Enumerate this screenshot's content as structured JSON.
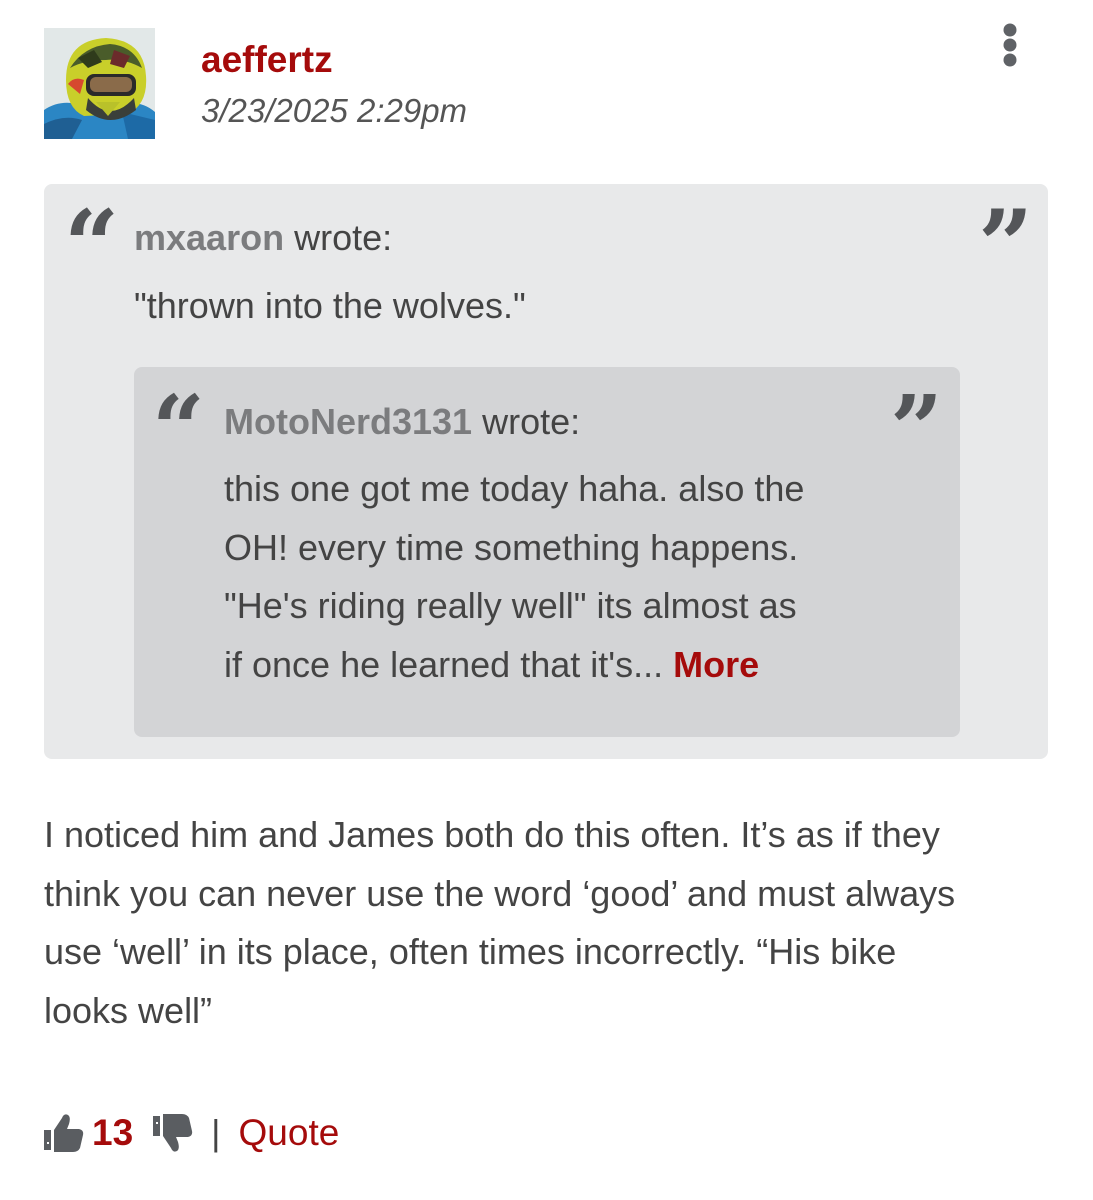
{
  "post": {
    "author": "aeffertz",
    "timestamp": "3/23/2025 2:29pm",
    "avatar_icon": "helmet-avatar",
    "menu_icon": "vertical-ellipsis-icon"
  },
  "quote_outer": {
    "author": "mxaaron",
    "wrote_label": "wrote:",
    "text": "\"thrown into the wolves.\""
  },
  "quote_inner": {
    "author": "MotoNerd3131",
    "wrote_label": "wrote:",
    "lines": [
      "this one got me today haha. also the",
      "OH! every time something happens.",
      "\"He's riding really well\" its almost as",
      "if once he learned that it's..."
    ],
    "more_label": "More"
  },
  "body": {
    "lines": [
      "I noticed him and James both do this often. It’s as if they",
      "think you can never use the word ‘good’ and must always",
      "use ‘well’ in its place, often times incorrectly. “His bike",
      "looks well”"
    ]
  },
  "footer": {
    "upvote_count": "13",
    "divider": "|",
    "quote_label": "Quote",
    "upvote_icon": "thumbs-up-icon",
    "downvote_icon": "thumbs-down-icon"
  },
  "colors": {
    "accent": "#a50b0b",
    "text": "#444444",
    "quote_outer_bg": "#e8e9ea",
    "quote_inner_bg": "#d3d4d6"
  }
}
